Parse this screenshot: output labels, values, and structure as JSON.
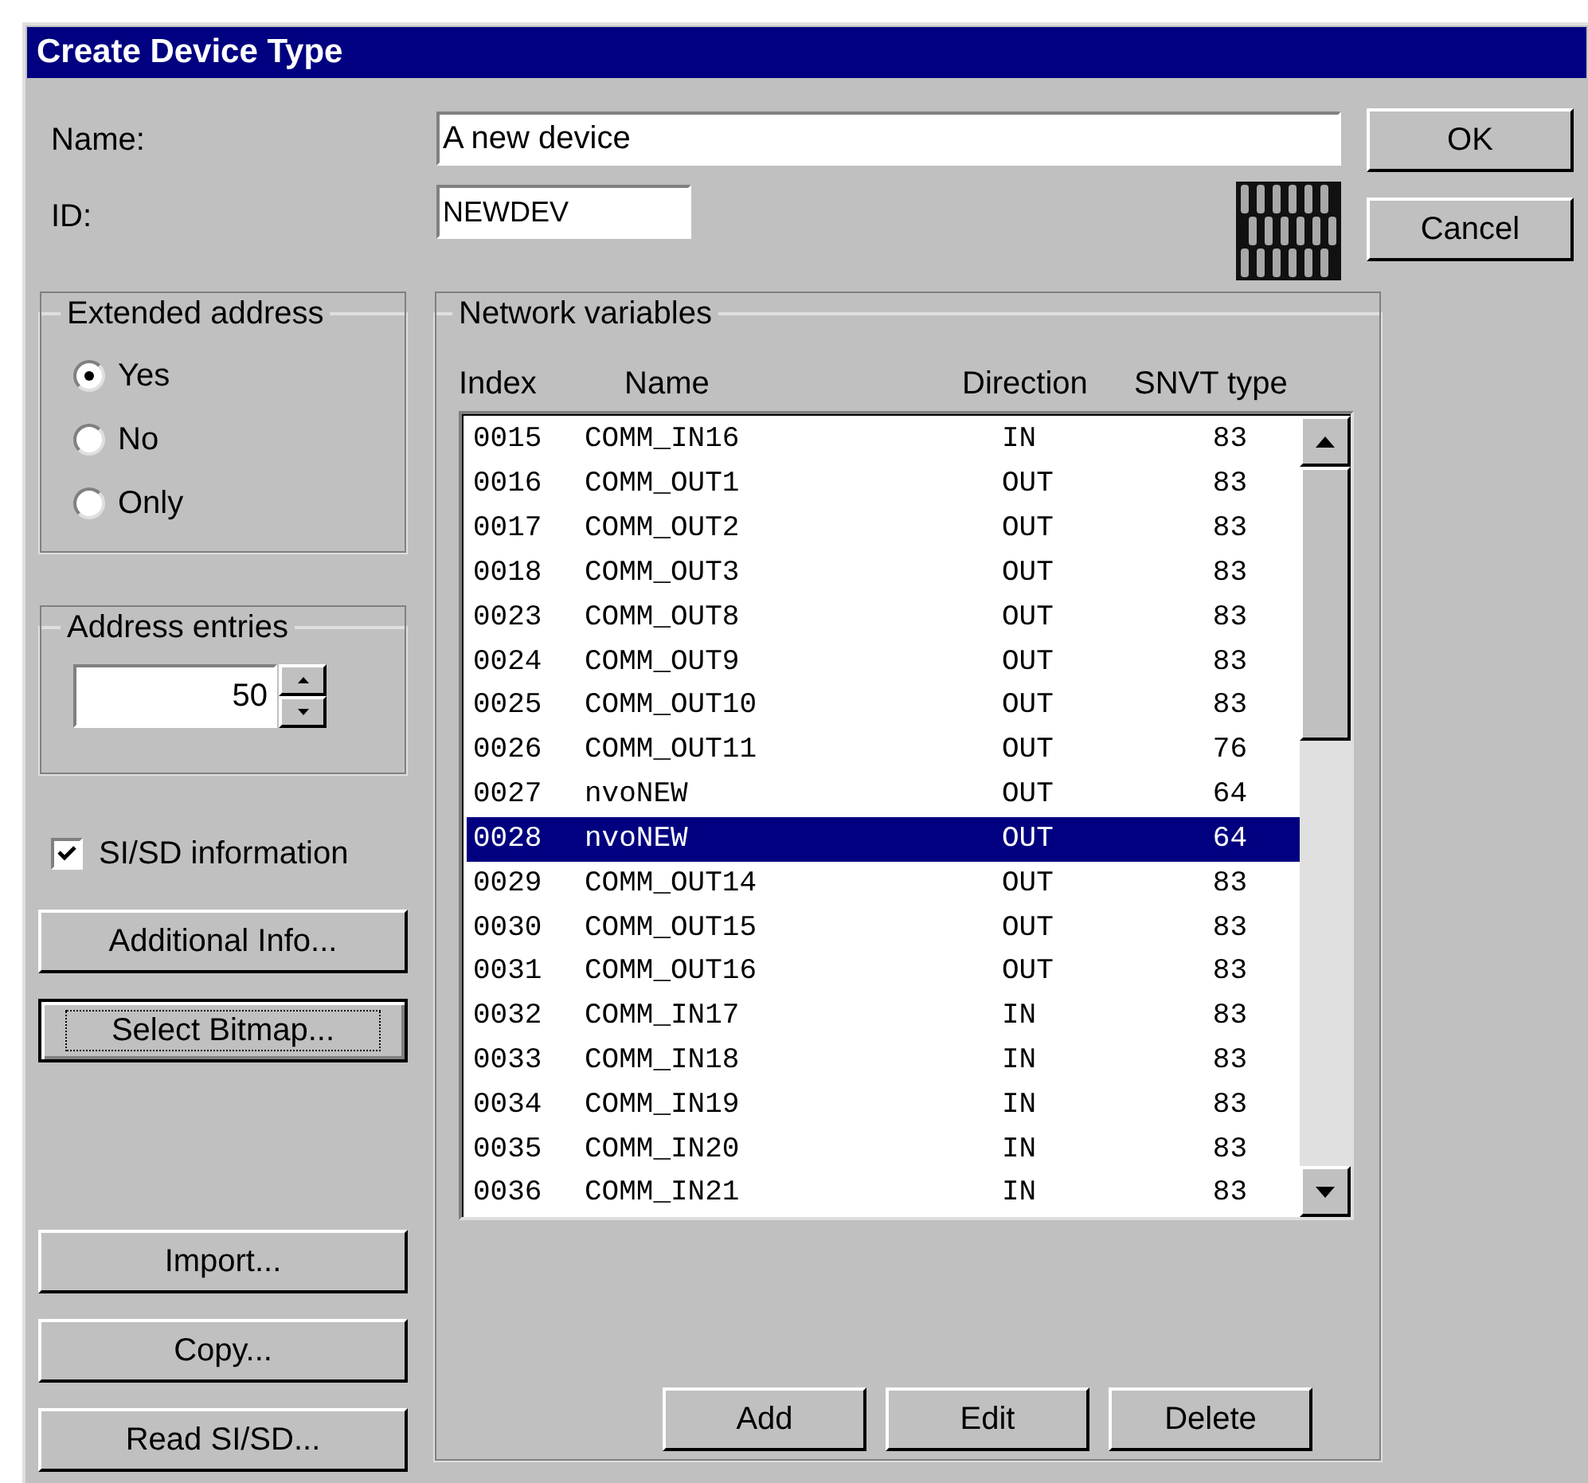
{
  "window": {
    "title": "Create Device Type"
  },
  "name_field": {
    "label": "Name:",
    "value": "A new device"
  },
  "id_field": {
    "label": "ID:",
    "value": "NEWDEV"
  },
  "dialog_buttons": [
    "OK",
    "Cancel"
  ],
  "extended_address": {
    "title": "Extended address",
    "options": [
      {
        "label": "Yes",
        "selected": true
      },
      {
        "label": "No",
        "selected": false
      },
      {
        "label": "Only",
        "selected": false
      }
    ]
  },
  "address_entries": {
    "title": "Address entries",
    "value": "50"
  },
  "si_sd_information": {
    "label": "SI/SD information",
    "checked": true
  },
  "side_buttons": [
    {
      "label": "Additional Info...",
      "focused": false
    },
    {
      "label": "Select Bitmap...",
      "focused": true
    }
  ],
  "file_buttons": [
    {
      "label": "Import...",
      "focused": false
    },
    {
      "label": "Copy...",
      "focused": false
    },
    {
      "label": "Read SI/SD...",
      "focused": false
    }
  ],
  "network_variables": {
    "title": "Network variables",
    "columns": [
      "Index",
      "Name",
      "Direction",
      "SNVT type"
    ],
    "rows": [
      {
        "index": "0015",
        "name": "COMM_IN16",
        "direction": "IN",
        "snvt_type": "83",
        "selected": false
      },
      {
        "index": "0016",
        "name": "COMM_OUT1",
        "direction": "OUT",
        "snvt_type": "83",
        "selected": false
      },
      {
        "index": "0017",
        "name": "COMM_OUT2",
        "direction": "OUT",
        "snvt_type": "83",
        "selected": false
      },
      {
        "index": "0018",
        "name": "COMM_OUT3",
        "direction": "OUT",
        "snvt_type": "83",
        "selected": false
      },
      {
        "index": "0023",
        "name": "COMM_OUT8",
        "direction": "OUT",
        "snvt_type": "83",
        "selected": false
      },
      {
        "index": "0024",
        "name": "COMM_OUT9",
        "direction": "OUT",
        "snvt_type": "83",
        "selected": false
      },
      {
        "index": "0025",
        "name": "COMM_OUT10",
        "direction": "OUT",
        "snvt_type": "83",
        "selected": false
      },
      {
        "index": "0026",
        "name": "COMM_OUT11",
        "direction": "OUT",
        "snvt_type": "76",
        "selected": false
      },
      {
        "index": "0027",
        "name": "nvoNEW",
        "direction": "OUT",
        "snvt_type": "64",
        "selected": false
      },
      {
        "index": "0028",
        "name": "nvoNEW",
        "direction": "OUT",
        "snvt_type": "64",
        "selected": true
      },
      {
        "index": "0029",
        "name": "COMM_OUT14",
        "direction": "OUT",
        "snvt_type": "83",
        "selected": false
      },
      {
        "index": "0030",
        "name": "COMM_OUT15",
        "direction": "OUT",
        "snvt_type": "83",
        "selected": false
      },
      {
        "index": "0031",
        "name": "COMM_OUT16",
        "direction": "OUT",
        "snvt_type": "83",
        "selected": false
      },
      {
        "index": "0032",
        "name": "COMM_IN17",
        "direction": "IN",
        "snvt_type": "83",
        "selected": false
      },
      {
        "index": "0033",
        "name": "COMM_IN18",
        "direction": "IN",
        "snvt_type": "83",
        "selected": false
      },
      {
        "index": "0034",
        "name": "COMM_IN19",
        "direction": "IN",
        "snvt_type": "83",
        "selected": false
      },
      {
        "index": "0035",
        "name": "COMM_IN20",
        "direction": "IN",
        "snvt_type": "83",
        "selected": false
      },
      {
        "index": "0036",
        "name": "COMM_IN21",
        "direction": "IN",
        "snvt_type": "83",
        "selected": false
      }
    ],
    "buttons": [
      "Add",
      "Edit",
      "Delete"
    ]
  }
}
